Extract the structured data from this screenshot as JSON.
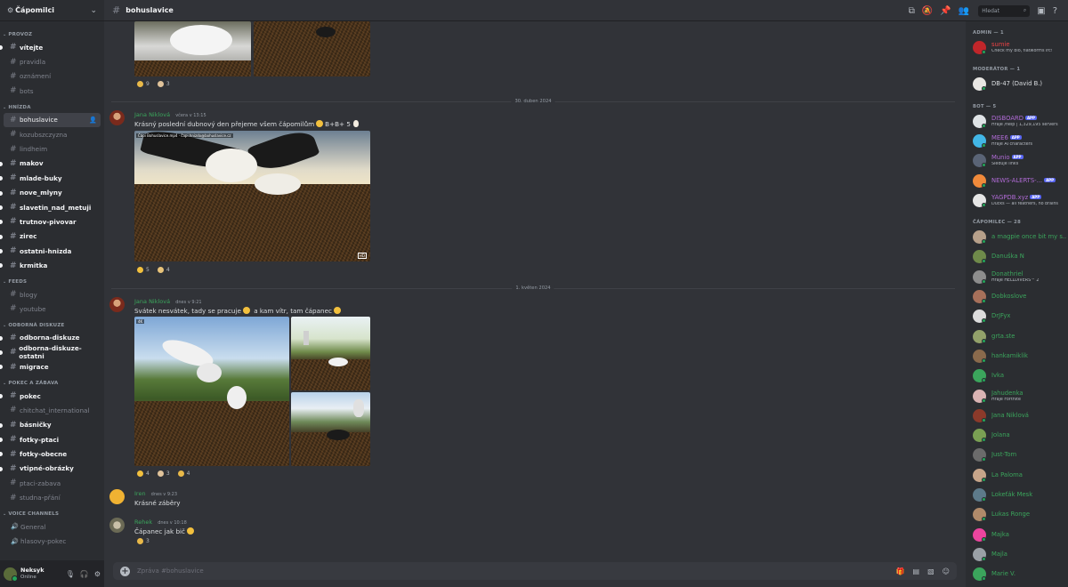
{
  "server": {
    "name": "Čápomilci"
  },
  "channel": {
    "name": "bohuslavice"
  },
  "sidebar": {
    "categories": [
      {
        "label": "PROVOZ",
        "channels": [
          {
            "name": "vítejte",
            "unread": true
          },
          {
            "name": "pravidla",
            "unread": false
          },
          {
            "name": "oznámení",
            "unread": false
          },
          {
            "name": "bots",
            "unread": false
          }
        ]
      },
      {
        "label": "HNÍZDA",
        "channels": [
          {
            "name": "bohuslavice",
            "unread": false,
            "active": true
          },
          {
            "name": "kozubszczyzna",
            "unread": false
          },
          {
            "name": "lindheim",
            "unread": false
          },
          {
            "name": "makov",
            "unread": true
          },
          {
            "name": "mlade-buky",
            "unread": true
          },
          {
            "name": "nove_mlyny",
            "unread": true
          },
          {
            "name": "slavetin_nad_metuji",
            "unread": true
          },
          {
            "name": "trutnov-pivovar",
            "unread": true
          },
          {
            "name": "zirec",
            "unread": true
          },
          {
            "name": "ostatni-hnizda",
            "unread": true
          },
          {
            "name": "krmitka",
            "unread": true
          }
        ]
      },
      {
        "label": "FEEDS",
        "channels": [
          {
            "name": "blogy",
            "unread": false
          },
          {
            "name": "youtube",
            "unread": false
          }
        ]
      },
      {
        "label": "ODBORNÁ DISKUZE",
        "channels": [
          {
            "name": "odborna-diskuze",
            "unread": true
          },
          {
            "name": "odborna-diskuze-ostatni",
            "unread": true
          },
          {
            "name": "migrace",
            "unread": true
          }
        ]
      },
      {
        "label": "POKEC A ZÁBAVA",
        "channels": [
          {
            "name": "pokec",
            "unread": true
          },
          {
            "name": "chitchat_international",
            "unread": false
          },
          {
            "name": "básničky",
            "unread": true
          },
          {
            "name": "fotky-ptaci",
            "unread": true
          },
          {
            "name": "fotky-obecne",
            "unread": true
          },
          {
            "name": "vtipné-obrázky",
            "unread": true
          },
          {
            "name": "ptaci-zabava",
            "unread": false
          },
          {
            "name": "studna-přání",
            "unread": false
          }
        ]
      },
      {
        "label": "VOICE CHANNELS",
        "voice": true,
        "channels": [
          {
            "name": "General",
            "unread": false
          },
          {
            "name": "hlasovy-pokec",
            "unread": false
          }
        ]
      }
    ]
  },
  "user": {
    "name": "Neksyk",
    "status": "Online"
  },
  "search": {
    "placeholder": "Hledat"
  },
  "top_reactions": [
    {
      "count": "9",
      "color": "#e9b949"
    },
    {
      "count": "3",
      "color": "#e0c39b"
    }
  ],
  "dividers": {
    "d1": "30. duben 2024",
    "d2": "1. květen 2024"
  },
  "messages": [
    {
      "author": "Jana Niklová",
      "author_color": "#3ba55c",
      "ts": "včera v 13:15",
      "text": "Krásný poslední dubnový den přejeme všem čápomilům",
      "text_suffix": "B+B+ 5",
      "image_overlay": "Čápi Bohuslavice.mp4  ·  čapi.hnizdo@bohuslavice.cz",
      "image_badge": "HD",
      "reactions": [
        {
          "count": "5",
          "color": "#f2c03e"
        },
        {
          "count": "4",
          "color": "#e8c37a"
        }
      ]
    },
    {
      "author": "Jana Niklová",
      "author_color": "#3ba55c",
      "ts": "dnes v 9:21",
      "text": "Svátek nesvátek, tady se pracuje",
      "text_middle": "a kam vítr, tam čápanec",
      "image_badge": "4K",
      "reactions": [
        {
          "count": "4",
          "color": "#f2c03e"
        },
        {
          "count": "3",
          "color": "#e0c39b"
        },
        {
          "count": "4",
          "color": "#e9b949"
        }
      ]
    },
    {
      "author": "Iren",
      "author_color": "#3ba55c",
      "ts": "dnes v 9:23",
      "text": "Krásné záběry"
    },
    {
      "author": "Rehek",
      "author_color": "#3ba55c",
      "ts": "dnes v 10:18",
      "text": "Čápanec jak bič",
      "reactions": [
        {
          "count": "3",
          "color": "#e9b949"
        }
      ]
    }
  ],
  "composer": {
    "placeholder": "Zpráva #bohuslavice"
  },
  "members": {
    "groups": [
      {
        "label": "ADMIN — 1",
        "members": [
          {
            "name": "sumie",
            "color": "#ed4245",
            "sub": "Check my bio, flatworms irc!",
            "avatar": "#c0262a"
          }
        ]
      },
      {
        "label": "MODERÁTOR — 1",
        "members": [
          {
            "name": "DB-47 (David B.)",
            "color": "#dbdee1",
            "sub": "",
            "avatar": "#e8e6e3"
          }
        ]
      },
      {
        "label": "BOT — 5",
        "members": [
          {
            "name": "DISBOARD",
            "color": "#b06bd6",
            "sub": "Hraje /help | 1,329,195 servers",
            "avatar": "#dfe3e6",
            "app": "APP"
          },
          {
            "name": "MEE6",
            "color": "#b06bd6",
            "sub": "Hraje AI characters",
            "avatar": "#42b6e6",
            "app": "APP"
          },
          {
            "name": "Munio",
            "color": "#b06bd6",
            "sub": "Sleduje links",
            "avatar": "#5a6476",
            "app": "APP"
          },
          {
            "name": "NEWS-ALERTS-...",
            "color": "#b06bd6",
            "sub": "",
            "avatar": "#f08a3b",
            "app": "APP"
          },
          {
            "name": "YAGPDB.xyz",
            "color": "#b06bd6",
            "sub": "Ducks — all feathers, no brains",
            "avatar": "#e6e6e6",
            "app": "APP"
          }
        ]
      },
      {
        "label": "ČÁPOMILEC — 28",
        "members": [
          {
            "name": "a magpie once bit my s...",
            "color": "#3ba55c",
            "sub": "",
            "avatar": "#b7a08a"
          },
          {
            "name": "Danuška N",
            "color": "#3ba55c",
            "sub": "",
            "avatar": "#6f8a4a"
          },
          {
            "name": "Donathriel",
            "color": "#3ba55c",
            "sub": "Hraje HELLDIVERS™ 2",
            "avatar": "#8d8d8d"
          },
          {
            "name": "Dobkoslove",
            "color": "#3ba55c",
            "sub": "",
            "avatar": "#a7705a"
          },
          {
            "name": "DrJFyx",
            "color": "#3ba55c",
            "sub": "",
            "avatar": "#dcdcdc"
          },
          {
            "name": "grta.ste",
            "color": "#3ba55c",
            "sub": "",
            "avatar": "#93a16a"
          },
          {
            "name": "hankamiklik",
            "color": "#3ba55c",
            "sub": "",
            "avatar": "#8a6a4c"
          },
          {
            "name": "Ivka",
            "color": "#3ba55c",
            "sub": "",
            "avatar": "#3ba55c"
          },
          {
            "name": "Jahudenka",
            "color": "#3ba55c",
            "sub": "Hraje Fortnite",
            "avatar": "#d9b3b3"
          },
          {
            "name": "Jana Niklová",
            "color": "#3ba55c",
            "sub": "",
            "avatar": "#8c3a2a"
          },
          {
            "name": "Jolana",
            "color": "#3ba55c",
            "sub": "",
            "avatar": "#7aa053"
          },
          {
            "name": "Just-Tom",
            "color": "#3ba55c",
            "sub": "",
            "avatar": "#6b6b6b"
          },
          {
            "name": "La Paloma",
            "color": "#3ba55c",
            "sub": "",
            "avatar": "#c7a58a"
          },
          {
            "name": "Lokeťák Mesk",
            "color": "#3ba55c",
            "sub": "",
            "avatar": "#5d7a8a"
          },
          {
            "name": "Lukas Ronge",
            "color": "#3ba55c",
            "sub": "",
            "avatar": "#b08a6a"
          },
          {
            "name": "Majka",
            "color": "#3ba55c",
            "sub": "",
            "avatar": "#eb459e"
          },
          {
            "name": "Majla",
            "color": "#3ba55c",
            "sub": "",
            "avatar": "#9aa0a6"
          },
          {
            "name": "Marie V.",
            "color": "#3ba55c",
            "sub": "",
            "avatar": "#3ba55c"
          }
        ]
      }
    ]
  }
}
